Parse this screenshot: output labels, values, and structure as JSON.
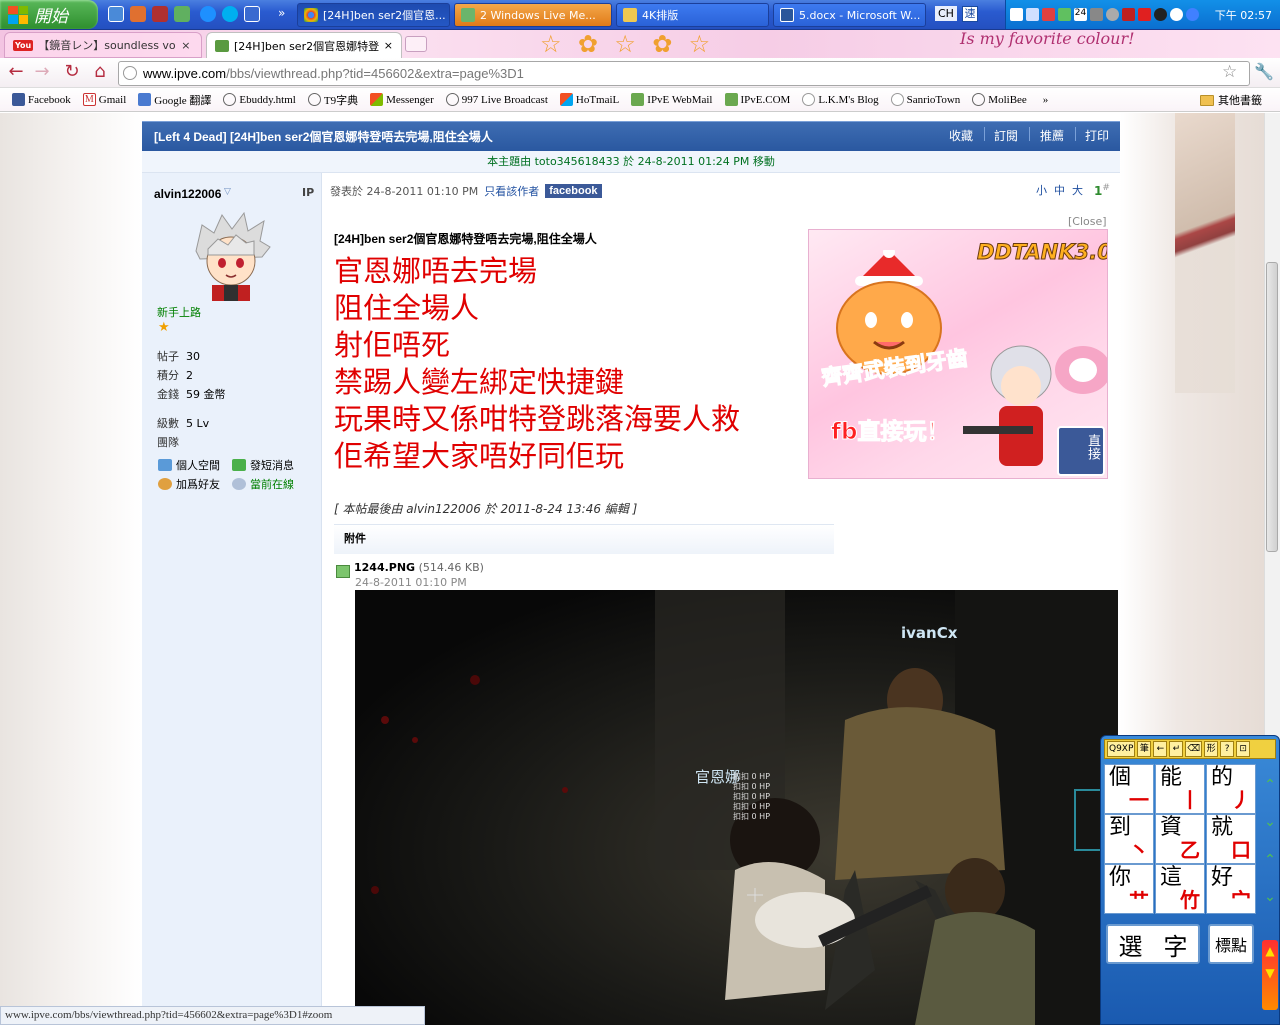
{
  "taskbar": {
    "start_label": "開始",
    "tasks": [
      {
        "label": "[24H]ben ser2個官恩..."
      },
      {
        "label": "2 Windows Live Me..."
      },
      {
        "label": "4K排版"
      },
      {
        "label": "5.docx - Microsoft W..."
      }
    ],
    "lang": "CH",
    "clock": "下午 02:57"
  },
  "browser": {
    "tabs": [
      {
        "label": "【鏡音レン】soundless voice"
      },
      {
        "label": "[24H]ben ser2個官恩娜特登唔去"
      }
    ],
    "url_domain": "www.ipve.com",
    "url_path": "/bbs/viewthread.php?tid=456602&extra=page%3D1",
    "bookmarks": [
      "Facebook",
      "Gmail",
      "Google 翻譯",
      "Ebuddy.html",
      "T9字典",
      "Messenger",
      "997 Live Broadcast",
      "HoTmaiL",
      "IPvE WebMail",
      "IPvE.COM",
      "L.K.M's Blog",
      "SanrioTown",
      "MoliBee"
    ],
    "other_bookmarks": "其他書籤",
    "status_url": "www.ipve.com/bbs/viewthread.php?tid=456602&extra=page%3D1#zoom"
  },
  "thread": {
    "title": "[Left 4 Dead] [24H]ben ser2個官恩娜特登唔去完場,阻住全場人",
    "actions": [
      "收藏",
      "訂閱",
      "推薦",
      "打印"
    ],
    "moved_notice": "本主題由 toto345618433 於 24-8-2011 01:24 PM 移動"
  },
  "author": {
    "name": "alvin122006",
    "ip_label": "IP",
    "rank": "新手上路",
    "stats": [
      {
        "label": "帖子",
        "value": "30"
      },
      {
        "label": "積分",
        "value": "2"
      },
      {
        "label": "金錢",
        "value": "59 金幣"
      },
      {
        "label": "級數",
        "value": "5 Lv"
      },
      {
        "label": "團隊",
        "value": ""
      }
    ],
    "links": [
      "個人空間",
      "發短消息",
      "加爲好友",
      "當前在線"
    ]
  },
  "post": {
    "posted_at": "發表於 24-8-2011 01:10 PM",
    "only_author": "只看該作者",
    "facebook": "facebook",
    "font_sizes": [
      "小",
      "中",
      "大"
    ],
    "floor": "1",
    "floor_mark": "#",
    "close_ad": "[Close]",
    "subject": "[24H]ben ser2個官恩娜特登唔去完場,阻住全場人",
    "lines": [
      "官恩娜唔去完場",
      "阻住全場人",
      "射佢唔死",
      "禁踢人變左綁定快捷鍵",
      "玩果時又係咁特登跳落海要人救",
      "佢希望大家唔好同佢玩"
    ],
    "edited": "[ 本帖最後由 alvin122006 於 2011-8-24 13:46 編輯 ]",
    "attach_header": "附件",
    "file_name": "1244.PNG",
    "file_size": "(514.46 KB)",
    "file_date": "24-8-2011 01:10 PM"
  },
  "ad": {
    "brand": "DDTANK3.0",
    "slogan": "齊齊武裝到牙齒",
    "cta": "fb直接玩！",
    "side": "直接"
  },
  "game": {
    "player1": "ivanCx",
    "player2": "官恩娜",
    "hp_lines": [
      "扣扣 0 HP",
      "扣扣 0 HP",
      "扣扣 0 HP",
      "扣扣 0 HP",
      "扣扣 0 HP"
    ]
  },
  "ime": {
    "bar": [
      "Q9XP",
      "筆",
      "←",
      "↵",
      "⌫",
      "形",
      "?",
      "⊡"
    ],
    "cells": [
      {
        "ch": "個",
        "stroke": "一"
      },
      {
        "ch": "能",
        "stroke": "丨"
      },
      {
        "ch": "的",
        "stroke": "丿"
      },
      {
        "ch": "到",
        "stroke": "丶"
      },
      {
        "ch": "資",
        "stroke": "乙"
      },
      {
        "ch": "就",
        "stroke": "口"
      },
      {
        "ch": "你",
        "stroke": "艹"
      },
      {
        "ch": "這",
        "stroke": "竹"
      },
      {
        "ch": "好",
        "stroke": "宀"
      }
    ],
    "select": [
      "選",
      "字"
    ],
    "punct": "標點"
  },
  "colors": {
    "thread_bar": "#2a58a0",
    "red_text": "#e00000",
    "rank_green": "#008000"
  }
}
